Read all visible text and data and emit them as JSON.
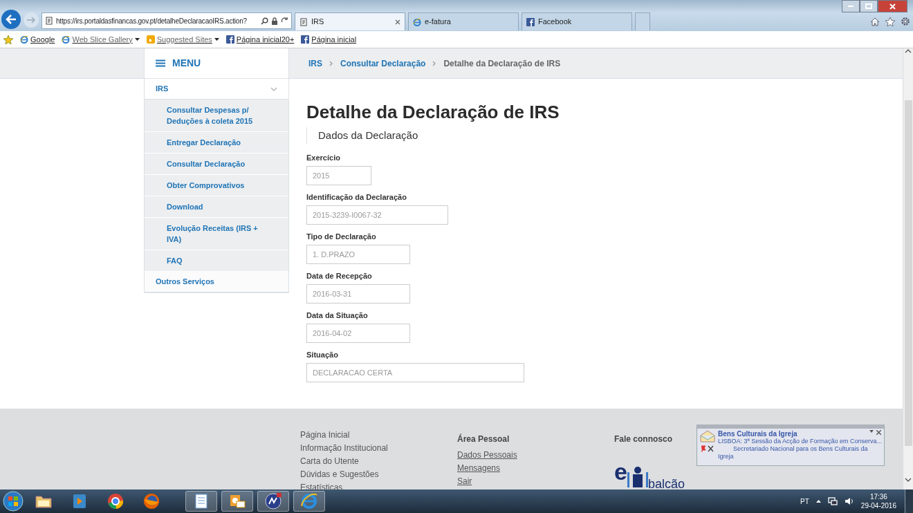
{
  "browser": {
    "address": {
      "url": "https://irs.portaldasfinancas.gov.pt/detalheDeclaracaoIRS.action?"
    },
    "tabs": [
      {
        "label": "IRS",
        "kind": "site",
        "selected": true
      },
      {
        "label": "e-fatura",
        "kind": "ie",
        "selected": false
      },
      {
        "label": "Facebook",
        "kind": "facebook",
        "selected": false
      }
    ],
    "favorites": [
      {
        "label": "Google",
        "kind": "ie",
        "dropdown": false
      },
      {
        "label": "Web Slice Gallery",
        "kind": "ie",
        "dropdown": true
      },
      {
        "label": "Suggested Sites",
        "kind": "bing",
        "dropdown": true
      },
      {
        "label": "Página inicial20+",
        "kind": "facebook",
        "dropdown": false
      },
      {
        "label": "Página inicial",
        "kind": "facebook",
        "dropdown": false
      }
    ]
  },
  "sidebar": {
    "menu_label": "MENU",
    "items": [
      {
        "label": "IRS",
        "expanded": true,
        "children": [
          {
            "label": "Consultar Despesas p/ Deduções à coleta 2015"
          },
          {
            "label": "Entregar Declaração"
          },
          {
            "label": "Consultar Declaração"
          },
          {
            "label": "Obter Comprovativos"
          },
          {
            "label": "Download"
          },
          {
            "label": "Evolução Receitas (IRS + IVA)"
          },
          {
            "label": "FAQ"
          }
        ]
      },
      {
        "label": "Outros Serviços",
        "expanded": false
      }
    ]
  },
  "breadcrumb": [
    {
      "label": "IRS",
      "current": false
    },
    {
      "label": "Consultar Declaração",
      "current": false
    },
    {
      "label": "Detalhe da Declaração de IRS",
      "current": true
    }
  ],
  "title": "Detalhe da Declaração de IRS",
  "section_title": "Dados da Declaração",
  "fields": [
    {
      "label": "Exercício",
      "value": "2015"
    },
    {
      "label": "Identificação da Declaração",
      "value": "2015-3239-I0067-32"
    },
    {
      "label": "Tipo de Declaração",
      "value": "1. D.PRAZO"
    },
    {
      "label": "Data de Recepção",
      "value": "2016-03-31"
    },
    {
      "label": "Data da Situação",
      "value": "2016-04-02"
    },
    {
      "label": "Situação",
      "value": "DECLARACAO CERTA"
    }
  ],
  "footer": {
    "links": [
      "Página Inicial",
      "Informação Institucional",
      "Carta do Utente",
      "Dúvidas e Sugestões",
      "Estatísticas"
    ],
    "personal": {
      "title": "Área Pessoal",
      "links": [
        "Dados Pessoais",
        "Mensagens",
        "Sair"
      ]
    },
    "contact": {
      "title": "Fale connosco",
      "logo_letter": "e",
      "logo_word": "balcão"
    }
  },
  "notification": {
    "sender": "Bens Culturais da Igreja",
    "subject": "LISBOA: 3ª Sessão da Acção de Formação em Conserva...",
    "body": "Secretariado Nacional para os Bens Culturais da Igreja"
  },
  "taskbar": {
    "apps": [
      {
        "kind": "folder",
        "running": false
      },
      {
        "kind": "media",
        "running": false
      },
      {
        "kind": "chrome",
        "running": false
      },
      {
        "kind": "firefox",
        "running": false
      },
      {
        "kind": "document",
        "running": true
      },
      {
        "kind": "mail",
        "running": true
      },
      {
        "kind": "globe",
        "running": true
      },
      {
        "kind": "ie",
        "running": true
      }
    ],
    "language": "PT",
    "time": "17:36",
    "date": "29-04-2016"
  }
}
